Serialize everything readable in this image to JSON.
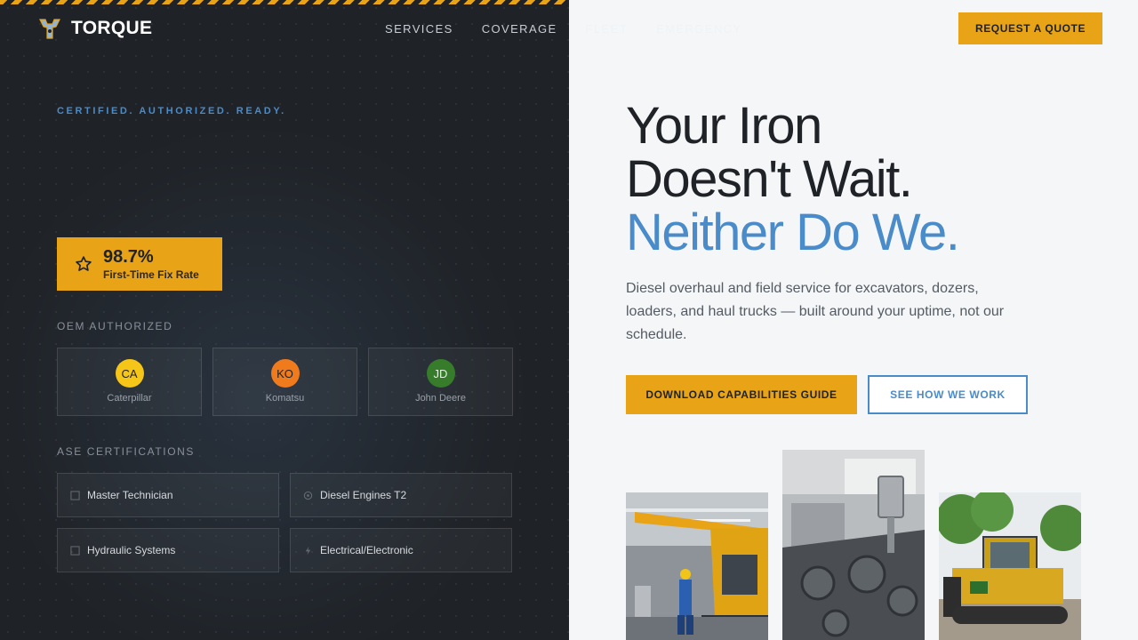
{
  "brand": {
    "name": "TORQUE",
    "logo_icon": "torque-logo-icon"
  },
  "nav": {
    "links": [
      "SERVICES",
      "COVERAGE",
      "FLEET",
      "EMERGENCY"
    ],
    "cta": "REQUEST A QUOTE"
  },
  "left": {
    "eyebrow": "CERTIFIED. AUTHORIZED. READY.",
    "stat": {
      "value": "98.7%",
      "label": "First-Time Fix Rate",
      "icon": "star-icon"
    },
    "oem_label": "OEM AUTHORIZED",
    "oems": [
      {
        "abbr": "CA",
        "name": "Caterpillar",
        "color": "#f5c518"
      },
      {
        "abbr": "KO",
        "name": "Komatsu",
        "color": "#f07b1d"
      },
      {
        "abbr": "JD",
        "name": "John Deere",
        "color": "#367c2b"
      }
    ],
    "cert_label": "ASE CERTIFICATIONS",
    "certs": [
      {
        "label": "Master Technician",
        "icon": "badge-icon"
      },
      {
        "label": "Diesel Engines T2",
        "icon": "gear-icon"
      },
      {
        "label": "Hydraulic Systems",
        "icon": "droplet-icon"
      },
      {
        "label": "Electrical/Electronic",
        "icon": "bolt-icon"
      }
    ]
  },
  "hero": {
    "line1": "Your Iron",
    "line2": "Doesn't Wait.",
    "line3": "Neither Do We.",
    "subtitle": "Diesel overhaul and field service for excavators, dozers, loaders, and haul trucks — built around your uptime, not our schedule.",
    "primary_cta": "DOWNLOAD CAPABILITIES GUIDE",
    "secondary_cta": "SEE HOW WE WORK"
  },
  "photos": [
    "excavator-repair-photo",
    "engine-block-photo",
    "yellow-dozer-photo"
  ],
  "colors": {
    "accent": "#e8a317",
    "blue": "#4a8bc9",
    "dark": "#1f2226",
    "light": "#f4f6f8"
  }
}
